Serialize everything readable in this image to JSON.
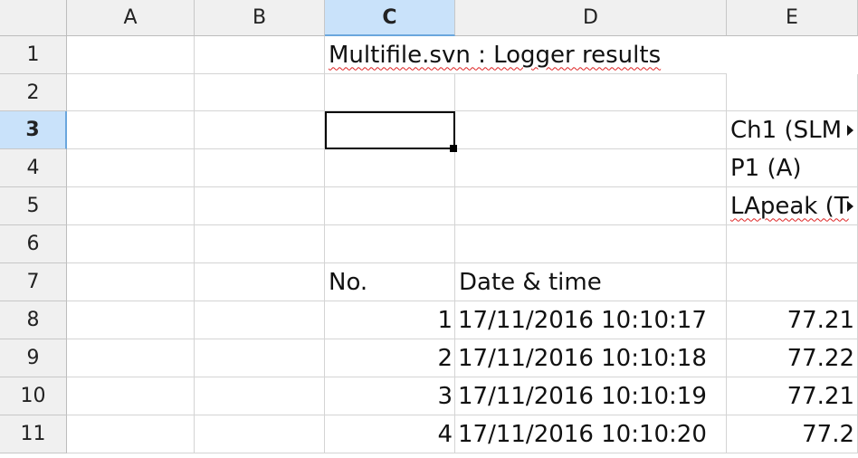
{
  "columns": [
    "A",
    "B",
    "C",
    "D",
    "E"
  ],
  "rows": [
    "1",
    "2",
    "3",
    "4",
    "5",
    "6",
    "7",
    "8",
    "9",
    "10",
    "11"
  ],
  "selected_column": "C",
  "selected_row": "3",
  "cells": {
    "C1": "Multifile.svn : Logger results",
    "E3": "Ch1 (SLM",
    "E4": "P1 (A)",
    "E5": "LApeak (T",
    "C7": "No.",
    "D7": "Date & time",
    "C8": "1",
    "D8": "17/11/2016 10:10:17",
    "E8": "77.21",
    "C9": "2",
    "D9": "17/11/2016 10:10:18",
    "E9": "77.22",
    "C10": "3",
    "D10": "17/11/2016 10:10:19",
    "E10": "77.21",
    "C11": "4",
    "D11": "17/11/2016 10:10:20",
    "E11": "77.2"
  },
  "colors": {
    "header_bg": "#f0f0f0",
    "selected_header_bg": "#c9e2fa",
    "grid": "#d4d4d4",
    "spellcheck": "#d22"
  }
}
